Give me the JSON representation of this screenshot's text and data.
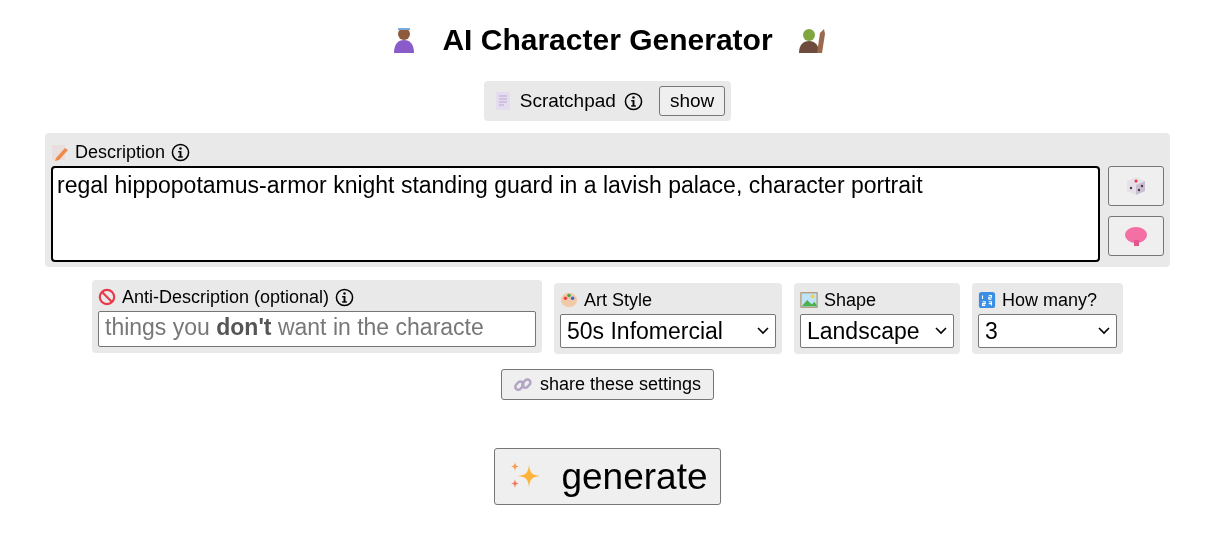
{
  "title": "AI Character Generator",
  "scratchpad": {
    "label": "Scratchpad",
    "button": "show"
  },
  "description": {
    "label": "Description",
    "value": "regal hippopotamus-armor knight standing guard in a lavish palace, character portrait"
  },
  "anti_description": {
    "label": "Anti-Description (optional)",
    "placeholder": "things you **don't** want in the characte"
  },
  "art_style": {
    "label": "Art Style",
    "value": "50s Infomercial"
  },
  "shape": {
    "label": "Shape",
    "value": "Landscape"
  },
  "how_many": {
    "label": "How many?",
    "value": "3"
  },
  "share_button": "share these settings",
  "generate_button": "generate"
}
